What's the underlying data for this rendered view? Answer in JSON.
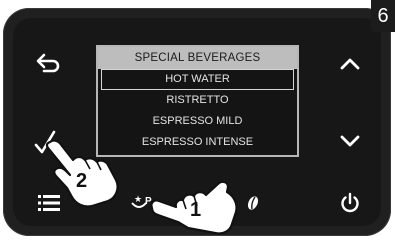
{
  "step_number": "6",
  "screen": {
    "title": "SPECIAL BEVERAGES",
    "items": [
      {
        "label": "HOT WATER",
        "selected": true
      },
      {
        "label": "RISTRETTO",
        "selected": false
      },
      {
        "label": "ESPRESSO MILD",
        "selected": false
      },
      {
        "label": "ESPRESSO INTENSE",
        "selected": false
      }
    ]
  },
  "buttons": {
    "back": "back-arrow-icon",
    "up": "chevron-up-icon",
    "down": "chevron-down-icon",
    "confirm": "checkmark-icon",
    "menu": "menu-list-icon",
    "special_beverages": "special-beverage-icon",
    "coffee_strength": "coffee-bean-icon",
    "power": "power-icon"
  },
  "callouts": [
    "1",
    "2"
  ]
}
